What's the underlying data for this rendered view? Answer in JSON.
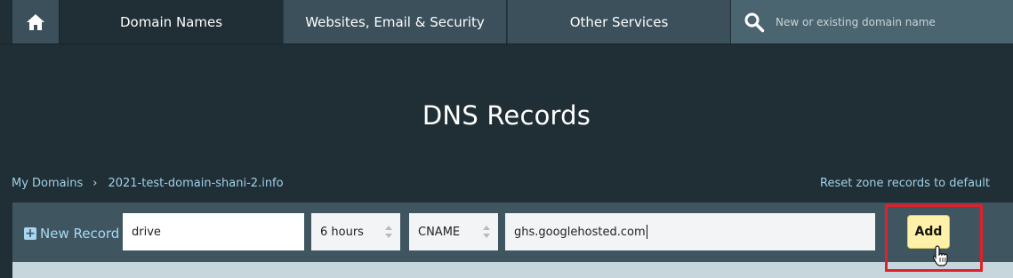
{
  "nav": {
    "home_icon": "home-icon",
    "tabs": [
      {
        "label": "Domain Names"
      },
      {
        "label": "Websites, Email & Security"
      },
      {
        "label": "Other Services"
      }
    ],
    "search": {
      "icon": "search-icon",
      "placeholder": "New or existing domain name"
    }
  },
  "page": {
    "title": "DNS Records"
  },
  "breadcrumb": {
    "root": "My Domains",
    "current": "2021-test-domain-shani-2.info"
  },
  "reset_link": "Reset zone records to default",
  "new_record": {
    "label": "New Record",
    "host": "drive",
    "ttl": "6 hours",
    "type": "CNAME",
    "value": "ghs.googlehosted.com",
    "add_label": "Add"
  },
  "colors": {
    "background": "#202f35",
    "link": "#9fd0e8",
    "add_button": "#fff2a8",
    "highlight": "#e0202a"
  }
}
